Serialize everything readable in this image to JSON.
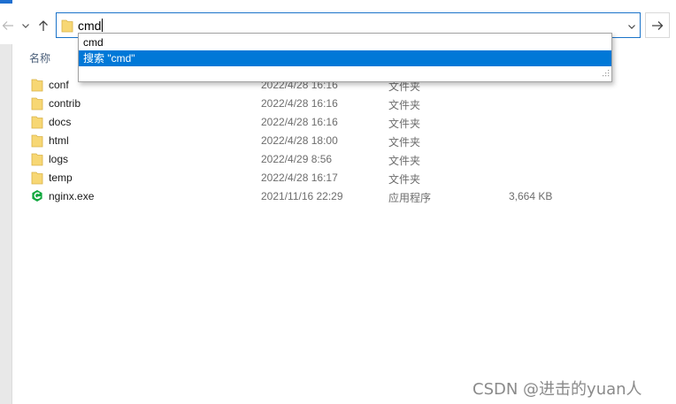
{
  "address": {
    "value": "cmd"
  },
  "suggestions": [
    {
      "label": "cmd"
    },
    {
      "label": "搜索 \"cmd\""
    }
  ],
  "columns": {
    "name": "名称"
  },
  "files": [
    {
      "name": "conf",
      "date": "2022/4/28 16:16",
      "type": "文件夹",
      "size": "",
      "icon": "folder-icon"
    },
    {
      "name": "contrib",
      "date": "2022/4/28 16:16",
      "type": "文件夹",
      "size": "",
      "icon": "folder-icon"
    },
    {
      "name": "docs",
      "date": "2022/4/28 16:16",
      "type": "文件夹",
      "size": "",
      "icon": "folder-icon"
    },
    {
      "name": "html",
      "date": "2022/4/28 18:00",
      "type": "文件夹",
      "size": "",
      "icon": "folder-icon"
    },
    {
      "name": "logs",
      "date": "2022/4/29 8:56",
      "type": "文件夹",
      "size": "",
      "icon": "folder-icon"
    },
    {
      "name": "temp",
      "date": "2022/4/28 16:17",
      "type": "文件夹",
      "size": "",
      "icon": "folder-icon"
    },
    {
      "name": "nginx.exe",
      "date": "2021/11/16 22:29",
      "type": "应用程序",
      "size": "3,664 KB",
      "icon": "nginx-app-icon"
    }
  ],
  "watermark": "CSDN @进击的yuan人",
  "colors": {
    "accent": "#0078d7",
    "address_border": "#1a73c9",
    "folder": "#f7d774",
    "nginx": "#11a83e"
  }
}
